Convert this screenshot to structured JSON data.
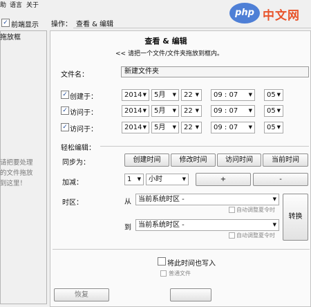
{
  "menu": {
    "item1": "助",
    "item2": "语言",
    "item3": "关于"
  },
  "logo": {
    "mark": "php",
    "text": "中文网"
  },
  "left": {
    "show_front_label": "前端显示",
    "panel_title": "拖放框",
    "hint_lines": [
      "请把要处理",
      "的文件拖放",
      "到这里！"
    ]
  },
  "operation": {
    "label": "操作：",
    "value": "查看 & 编辑"
  },
  "section": {
    "title": "查看 & 编辑",
    "subtitle": "<< 请把一个文件/文件夹拖放到框内。"
  },
  "filename": {
    "label": "文件名：",
    "value": "新建文件夹"
  },
  "time_rows": [
    {
      "label": "创建于：",
      "year": "2014",
      "month": "5月",
      "day": "22",
      "hour": "09",
      "minute": "07",
      "second": "05"
    },
    {
      "label": "访问于：",
      "year": "2014",
      "month": "5月",
      "day": "22",
      "hour": "09",
      "minute": "07",
      "second": "05"
    },
    {
      "label": "访问于：",
      "year": "2014",
      "month": "5月",
      "day": "22",
      "hour": "09",
      "minute": "07",
      "second": "05"
    }
  ],
  "time_sep": ":",
  "easy_edit": {
    "title": "轻松编辑："
  },
  "sync": {
    "label": "同步为：",
    "buttons": [
      "创建时间",
      "修改时间",
      "访问时间",
      "当前时间"
    ]
  },
  "adjust": {
    "label": "加减：",
    "amount": "1",
    "unit": "小时",
    "plus": "+",
    "minus": "-"
  },
  "timezone": {
    "label": "时区：",
    "from_label": "从",
    "to_label": "到",
    "from_value": "当前系统时区 -",
    "to_value": "当前系统时区 -",
    "auto_adjust": "自动调整夏令时",
    "convert_button": "转换"
  },
  "footer": {
    "write_note": "将此时间也写入",
    "option1": "普通文件",
    "undo_button": "恢复"
  }
}
